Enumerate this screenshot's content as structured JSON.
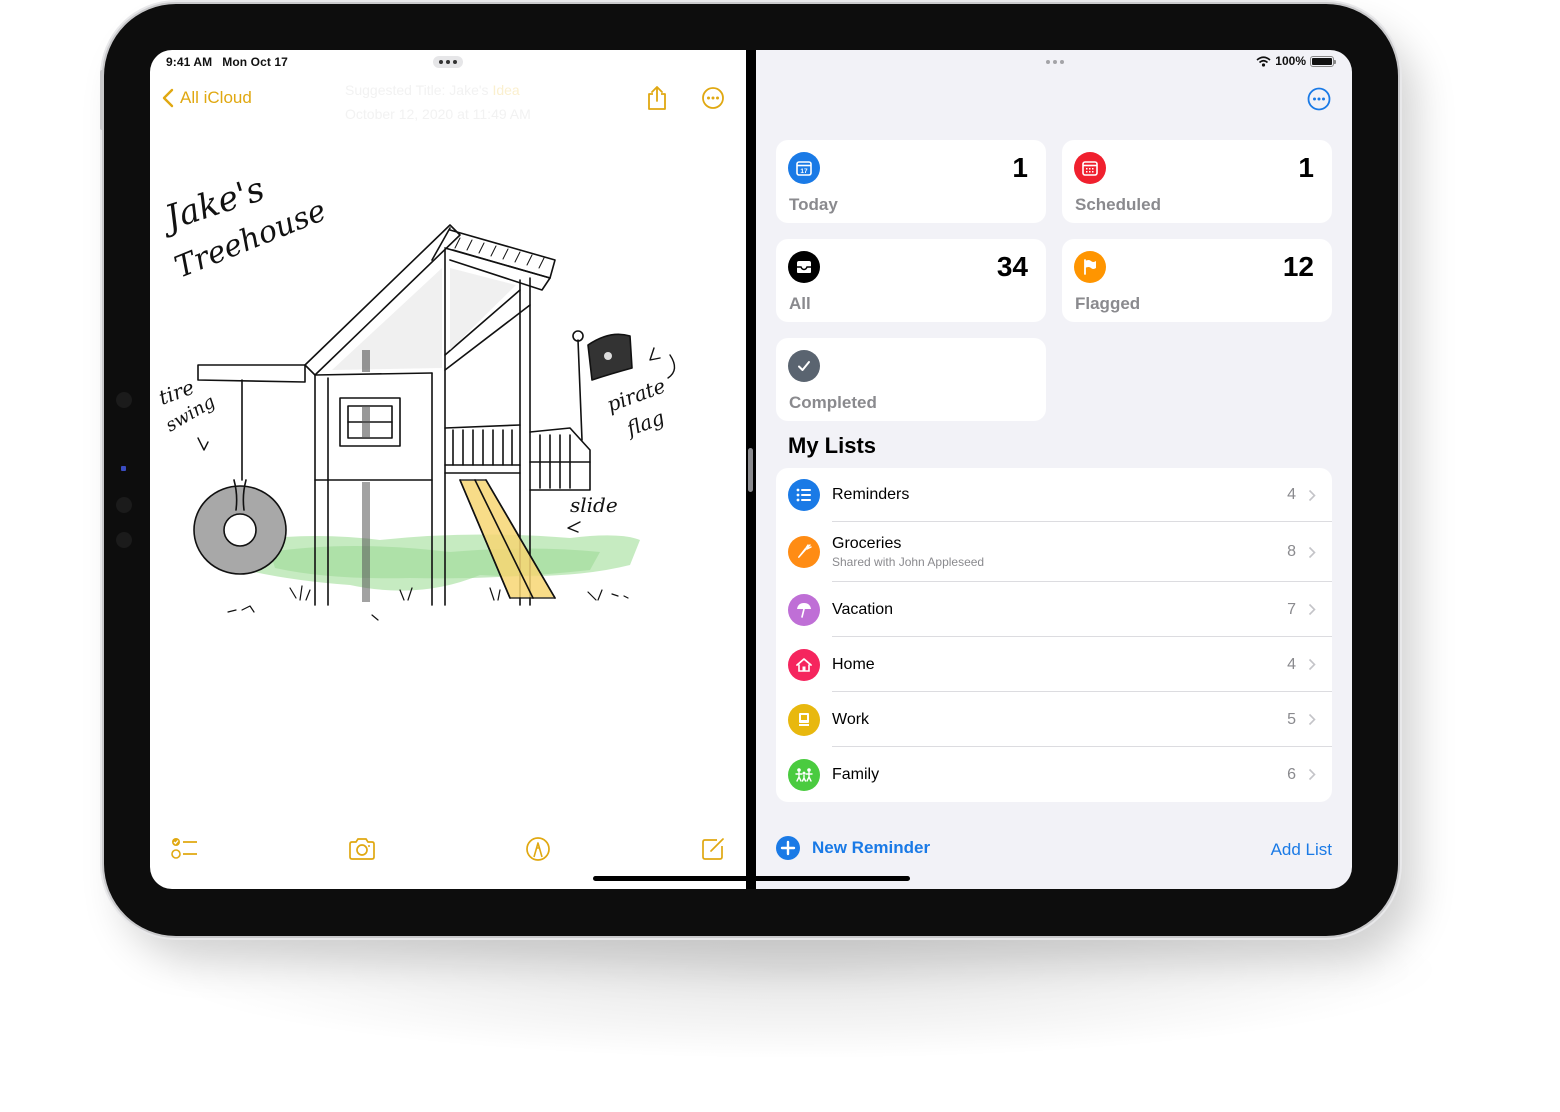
{
  "status_bar": {
    "time": "9:41 AM",
    "date": "Mon Oct 17",
    "battery": "100%"
  },
  "notes": {
    "back_label": "All iCloud",
    "ghost_title": "Suggested Title: Jake's",
    "ghost_title_accent": "Idea",
    "ghost_date": "October 12, 2020 at 11:49 AM",
    "accent_color": "#E0A811",
    "drawing": {
      "title_line1": "Jake's",
      "title_line2": "Treehouse",
      "annotation_tire_1": "tire",
      "annotation_tire_2": "swing",
      "annotation_flag_1": "pirate",
      "annotation_flag_2": "flag",
      "annotation_slide": "slide"
    },
    "toolbar": [
      "checklist-icon",
      "camera-icon",
      "markup-icon",
      "compose-icon"
    ]
  },
  "reminders": {
    "accent_color": "#1A7AE6",
    "smart_lists": [
      {
        "label": "Today",
        "count": "1",
        "icon": "calendar-today-icon",
        "color": "#1A7AE6"
      },
      {
        "label": "Scheduled",
        "count": "1",
        "icon": "calendar-scheduled-icon",
        "color": "#F0202E"
      },
      {
        "label": "All",
        "count": "34",
        "icon": "tray-icon",
        "color": "#000000"
      },
      {
        "label": "Flagged",
        "count": "12",
        "icon": "flag-icon",
        "color": "#FF9500"
      },
      {
        "label": "Completed",
        "count": "",
        "icon": "checkmark-icon",
        "color": "#5A6470"
      }
    ],
    "my_lists_title": "My Lists",
    "lists": [
      {
        "name": "Reminders",
        "sub": "",
        "count": "4",
        "icon": "list-bullet-icon",
        "color": "#1A7AE6"
      },
      {
        "name": "Groceries",
        "sub": "Shared with John Appleseed",
        "count": "8",
        "icon": "carrot-icon",
        "color": "#FF8C14"
      },
      {
        "name": "Vacation",
        "sub": "",
        "count": "7",
        "icon": "umbrella-icon",
        "color": "#BF6FD6"
      },
      {
        "name": "Home",
        "sub": "",
        "count": "4",
        "icon": "house-icon",
        "color": "#F5255E"
      },
      {
        "name": "Work",
        "sub": "",
        "count": "5",
        "icon": "desktop-icon",
        "color": "#E8B80E"
      },
      {
        "name": "Family",
        "sub": "",
        "count": "6",
        "icon": "people-icon",
        "color": "#4ACB3F"
      }
    ],
    "new_reminder_label": "New Reminder",
    "add_list_label": "Add List"
  }
}
